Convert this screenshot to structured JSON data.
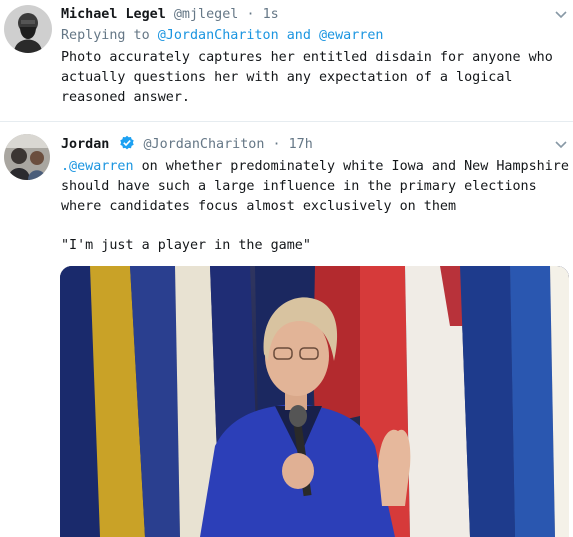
{
  "tweet1": {
    "display_name": "Michael Legel",
    "handle": "@mjlegel",
    "separator": "·",
    "time": "1s",
    "replying_prefix": "Replying to",
    "reply_handle_1": "@JordanChariton",
    "reply_and": "and",
    "reply_handle_2": "@ewarren",
    "text_lines": [
      "Photo accurately captures her entitled disdain for anyone who",
      "actually questions her with any expectation of a logical",
      "reasoned answer."
    ]
  },
  "tweet2": {
    "display_name": "Jordan",
    "handle": "@JordanChariton",
    "separator": "·",
    "time": "17h",
    "mention": ".@ewarren",
    "text_line1_rest": " on whether predominately white Iowa and New Hampshire",
    "text_lines": [
      "should have such a large influence in the primary elections",
      "where candidates focus almost exclusively on them"
    ],
    "quote_line": "\"I'm just a player in the game\""
  },
  "icons": {
    "caret": "chevron-down-icon",
    "verified": "verified-badge-icon"
  },
  "colors": {
    "link": "#1b95e0",
    "muted": "#657786",
    "text": "#14171a",
    "verified": "#1da1f2"
  }
}
